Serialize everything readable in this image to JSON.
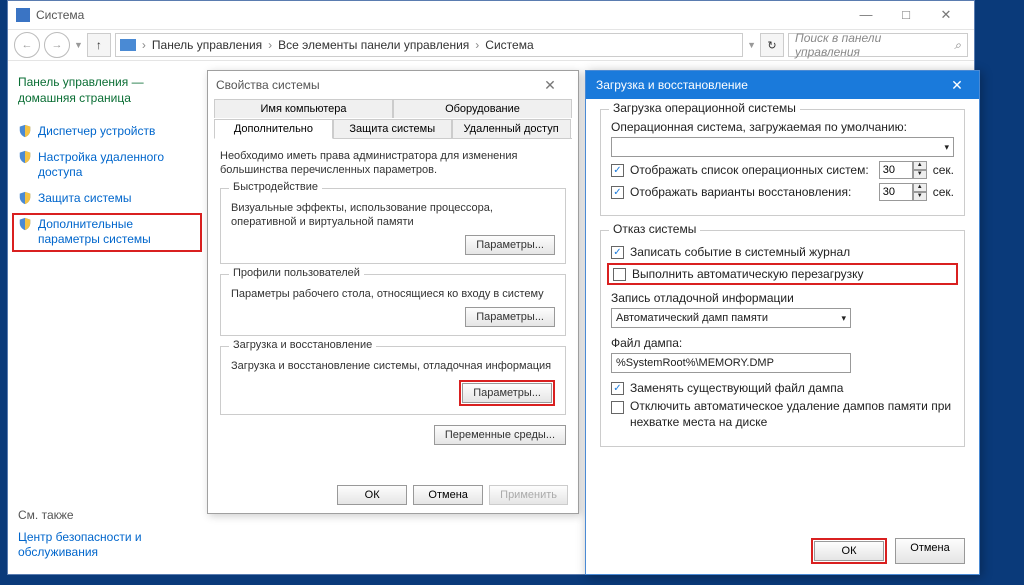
{
  "cp": {
    "title": "Система",
    "breadcrumbs": [
      "Панель управления",
      "Все элементы панели управления",
      "Система"
    ],
    "search_placeholder": "Поиск в панели управления",
    "sidebar": {
      "home": "Панель управления — домашняя страница",
      "items": [
        "Диспетчер устройств",
        "Настройка удаленного доступа",
        "Защита системы",
        "Дополнительные параметры системы"
      ],
      "see_also_title": "См. также",
      "see_also_item": "Центр безопасности и обслуживания"
    }
  },
  "sp": {
    "title": "Свойства системы",
    "tabs_row1": [
      "Имя компьютера",
      "Оборудование"
    ],
    "tabs_row2": [
      "Дополнительно",
      "Защита системы",
      "Удаленный доступ"
    ],
    "note": "Необходимо иметь права администратора для изменения большинства перечисленных параметров.",
    "perf": {
      "legend": "Быстродействие",
      "desc": "Визуальные эффекты, использование процессора, оперативной и виртуальной памяти",
      "btn": "Параметры..."
    },
    "prof": {
      "legend": "Профили пользователей",
      "desc": "Параметры рабочего стола, относящиеся ко входу в систему",
      "btn": "Параметры..."
    },
    "startup": {
      "legend": "Загрузка и восстановление",
      "desc": "Загрузка и восстановление системы, отладочная информация",
      "btn": "Параметры..."
    },
    "env_btn": "Переменные среды...",
    "footer": {
      "ok": "ОК",
      "cancel": "Отмена",
      "apply": "Применить"
    }
  },
  "sr": {
    "title": "Загрузка и восстановление",
    "boot": {
      "legend": "Загрузка операционной системы",
      "default_os_label": "Операционная система, загружаемая по умолчанию:",
      "default_os_value": "",
      "show_list_label": "Отображать список операционных систем:",
      "show_recovery_label": "Отображать варианты восстановления:",
      "seconds": "сек.",
      "show_list_sec": "30",
      "show_recovery_sec": "30",
      "show_list_checked": true,
      "show_recovery_checked": true
    },
    "failure": {
      "legend": "Отказ системы",
      "log_event": "Записать событие в системный журнал",
      "auto_restart": "Выполнить автоматическую перезагрузку",
      "log_event_checked": true,
      "auto_restart_checked": false,
      "debug_label": "Запись отладочной информации",
      "debug_value": "Автоматический дамп памяти",
      "dump_file_label": "Файл дампа:",
      "dump_file_value": "%SystemRoot%\\MEMORY.DMP",
      "overwrite": "Заменять существующий файл дампа",
      "overwrite_checked": true,
      "disable_auto_delete": "Отключить автоматическое удаление дампов памяти при нехватке места на диске",
      "disable_auto_delete_checked": false
    },
    "footer": {
      "ok": "ОК",
      "cancel": "Отмена"
    }
  }
}
